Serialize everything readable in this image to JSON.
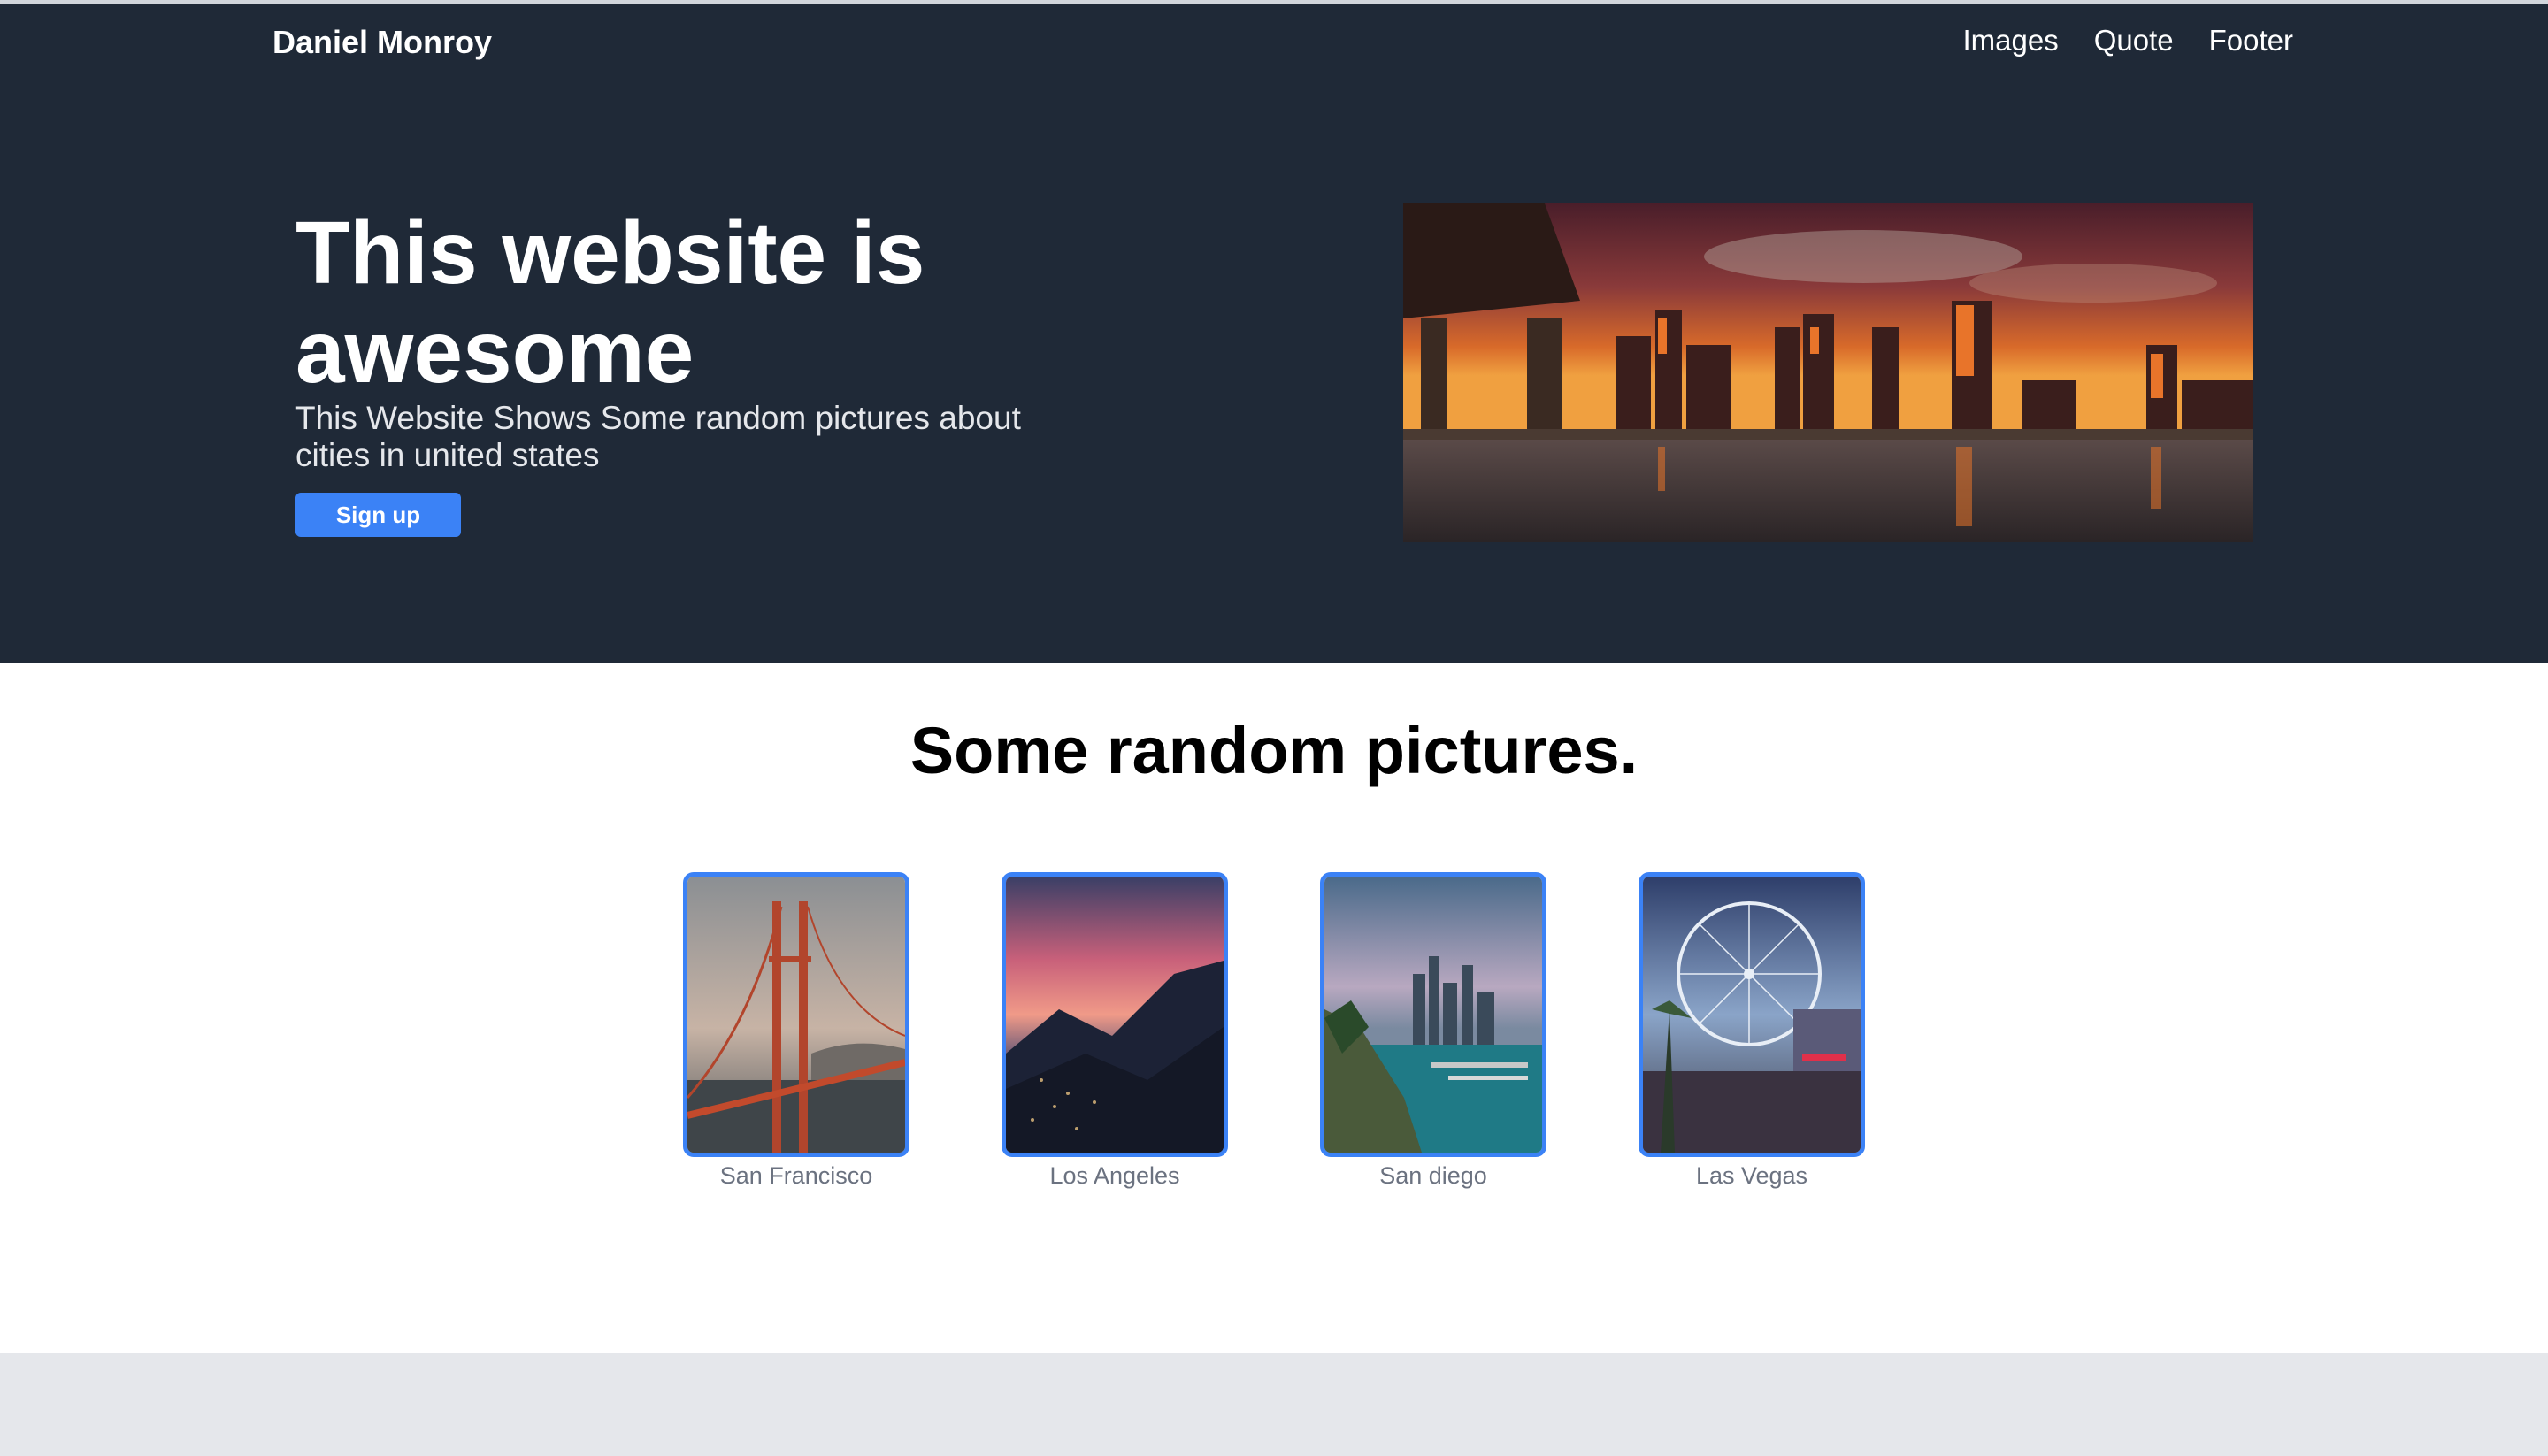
{
  "header": {
    "brand": "Daniel Monroy",
    "nav": [
      "Images",
      "Quote",
      "Footer"
    ]
  },
  "hero": {
    "title": "This website is awesome",
    "subtitle": "This Website Shows Some random pictures about cities in united states",
    "signup_label": "Sign up",
    "image": "city-skyline-sunset-photo"
  },
  "gallery": {
    "title": "Some random pictures.",
    "items": [
      {
        "caption": "San Francisco",
        "image": "golden-gate-bridge-photo"
      },
      {
        "caption": "Los Angeles",
        "image": "hills-sunset-photo"
      },
      {
        "caption": "San diego",
        "image": "harbor-skyline-photo"
      },
      {
        "caption": "Las Vegas",
        "image": "ferris-wheel-photo"
      }
    ]
  },
  "colors": {
    "hero_bg": "#1f2937",
    "accent": "#3b82f6",
    "section_bg": "#ffffff",
    "footer_bg": "#e5e7eb"
  }
}
